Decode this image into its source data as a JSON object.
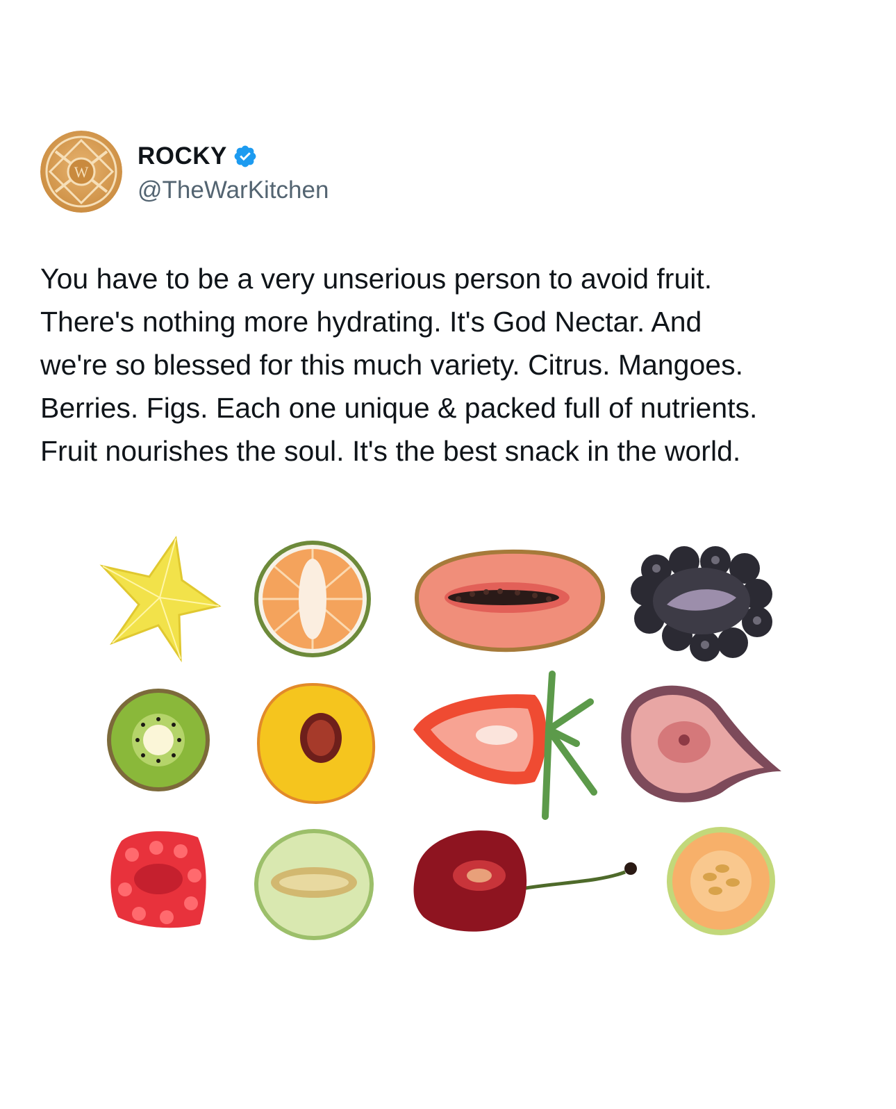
{
  "author": {
    "display_name": "ROCKY",
    "handle": "@TheWarKitchen",
    "verified": true,
    "verified_color": "#1d9bf0",
    "avatar_icon": "war-kitchen-logo",
    "avatar_letter": "W"
  },
  "tweet": {
    "lines": [
      "You have to be a very unserious person to avoid fruit.",
      "There's nothing more hydrating. It's God Nectar. And",
      "we're so blessed for this much variety. Citrus. Mangoes.",
      "Berries. Figs. Each one unique & packed full of nutrients.",
      "Fruit nourishes the soul. It's the best snack in the world."
    ]
  },
  "media": {
    "fruits": [
      {
        "name": "starfruit",
        "color": "#f2e24a"
      },
      {
        "name": "mandarin",
        "color": "#f4a35c"
      },
      {
        "name": "papaya",
        "color": "#e8715a"
      },
      {
        "name": "blackberry",
        "color": "#2b2a33"
      },
      {
        "name": "kiwi",
        "color": "#8ab83a"
      },
      {
        "name": "peach",
        "color": "#f5c51e"
      },
      {
        "name": "strawberry",
        "color": "#ef4b32"
      },
      {
        "name": "fig",
        "color": "#e8a6a4"
      },
      {
        "name": "raspberry",
        "color": "#e8323c"
      },
      {
        "name": "honeydew",
        "color": "#d9e8b0"
      },
      {
        "name": "cherry",
        "color": "#8e1420"
      },
      {
        "name": "cantaloupe",
        "color": "#f7b06a"
      }
    ]
  }
}
